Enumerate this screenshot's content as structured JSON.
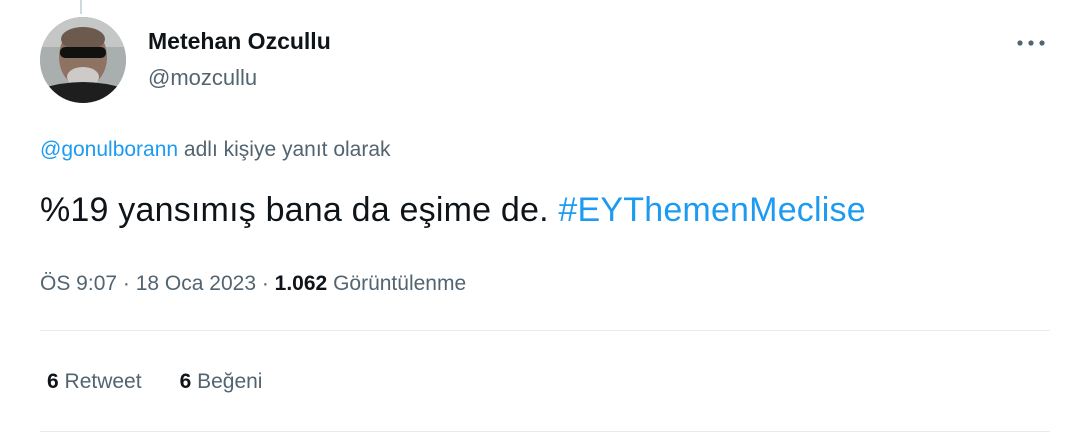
{
  "author": {
    "display_name": "Metehan Ozcullu",
    "handle": "@mozcullu"
  },
  "reply_context": {
    "mention": "@gonulborann",
    "suffix": " adlı kişiye yanıt olarak"
  },
  "tweet": {
    "text": "%19 yansımış bana da eşime de. ",
    "hashtag": "#EYThemenMeclise"
  },
  "meta": {
    "time": "ÖS 9:07",
    "separator": " · ",
    "date": "18 Oca 2023",
    "views_count": "1.062",
    "views_label": " Görüntülenme"
  },
  "stats": {
    "retweets_count": "6",
    "retweets_label": " Retweet",
    "likes_count": "6",
    "likes_label": " Beğeni"
  },
  "icons": {
    "more": "more-horizontal-icon"
  },
  "colors": {
    "link": "#1d9bf0",
    "secondary_text": "#536471",
    "primary_text": "#0f1419",
    "divider": "#e6ecf0"
  }
}
